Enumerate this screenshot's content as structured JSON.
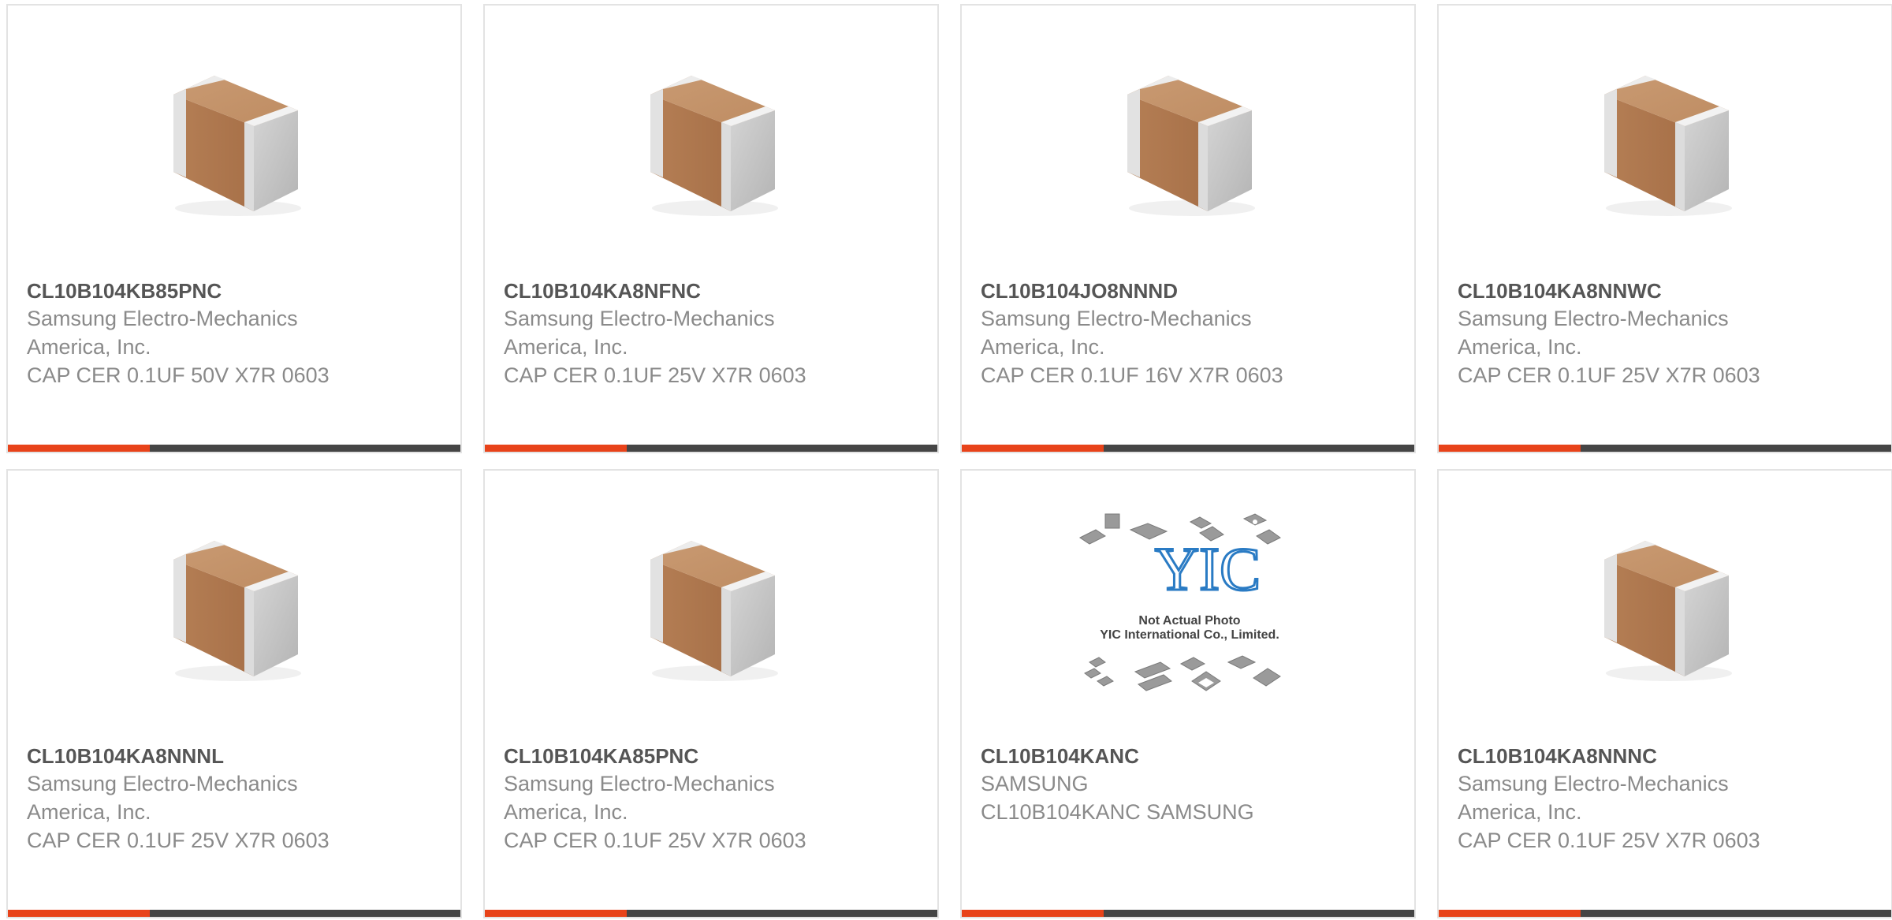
{
  "accent_color": "#e8431a",
  "products": [
    {
      "part_number": "CL10B104KB85PNC",
      "manufacturer_line1": "Samsung Electro-Mechanics",
      "manufacturer_line2": "America, Inc.",
      "description": "CAP CER 0.1UF 50V X7R 0603",
      "image": "capacitor-chip-icon"
    },
    {
      "part_number": "CL10B104KA8NFNC",
      "manufacturer_line1": "Samsung Electro-Mechanics",
      "manufacturer_line2": "America, Inc.",
      "description": "CAP CER 0.1UF 25V X7R 0603",
      "image": "capacitor-chip-icon"
    },
    {
      "part_number": "CL10B104JO8NNND",
      "manufacturer_line1": "Samsung Electro-Mechanics",
      "manufacturer_line2": "America, Inc.",
      "description": "CAP CER 0.1UF 16V X7R 0603",
      "image": "capacitor-chip-icon"
    },
    {
      "part_number": "CL10B104KA8NNWC",
      "manufacturer_line1": "Samsung Electro-Mechanics",
      "manufacturer_line2": "America, Inc.",
      "description": "CAP CER 0.1UF 25V X7R 0603",
      "image": "capacitor-chip-icon"
    },
    {
      "part_number": "CL10B104KA8NNNL",
      "manufacturer_line1": "Samsung Electro-Mechanics",
      "manufacturer_line2": "America, Inc.",
      "description": "CAP CER 0.1UF 25V X7R 0603",
      "image": "capacitor-chip-icon"
    },
    {
      "part_number": "CL10B104KA85PNC",
      "manufacturer_line1": "Samsung Electro-Mechanics",
      "manufacturer_line2": "America, Inc.",
      "description": "CAP CER 0.1UF 25V X7R 0603",
      "image": "capacitor-chip-icon"
    },
    {
      "part_number": "CL10B104KANC",
      "manufacturer_line1": "SAMSUNG",
      "manufacturer_line2": "CL10B104KANC SAMSUNG",
      "description": "",
      "image": "placeholder-photo-icon",
      "placeholder": {
        "logo": "YIC",
        "caption1": "Not Actual Photo",
        "caption2": "YIC International Co., Limited."
      }
    },
    {
      "part_number": "CL10B104KA8NNNC",
      "manufacturer_line1": "Samsung Electro-Mechanics",
      "manufacturer_line2": "America, Inc.",
      "description": "CAP CER 0.1UF 25V X7R 0603",
      "image": "capacitor-chip-icon"
    }
  ]
}
